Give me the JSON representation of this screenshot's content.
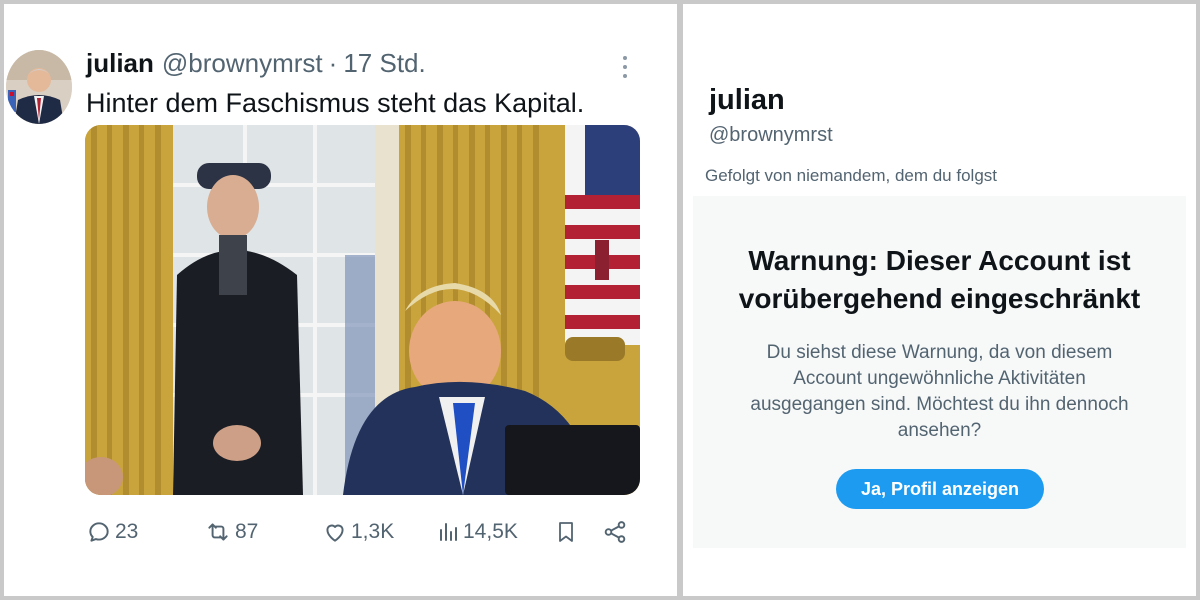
{
  "tweet": {
    "author_name": "julian",
    "author_handle": "@brownymrst",
    "separator": "·",
    "time": "17 Std.",
    "text": "Hinter dem Faschismus steht das Kapital.",
    "more_icon": "more-horizontal-icon",
    "media_icon": "photo",
    "actions": {
      "replies": "23",
      "reposts": "87",
      "likes": "1,3K",
      "views": "14,5K"
    },
    "colors": {
      "text": "#0f1419",
      "muted": "#536471"
    }
  },
  "profile": {
    "name": "julian",
    "handle": "@brownymrst",
    "followed_by": "Gefolgt von niemandem, dem du folgst",
    "warning_title": "Warnung: Dieser Account ist vorübergehend eingeschränkt",
    "warning_text": "Du siehst diese Warnung, da von diesem Account ungewöhnliche Aktivitäten ausgegangen sind. Möchtest du ihn dennoch ansehen?",
    "button_label": "Ja, Profil anzeigen",
    "colors": {
      "accent": "#1d9bf0",
      "box_bg": "#f7f9f9"
    }
  }
}
